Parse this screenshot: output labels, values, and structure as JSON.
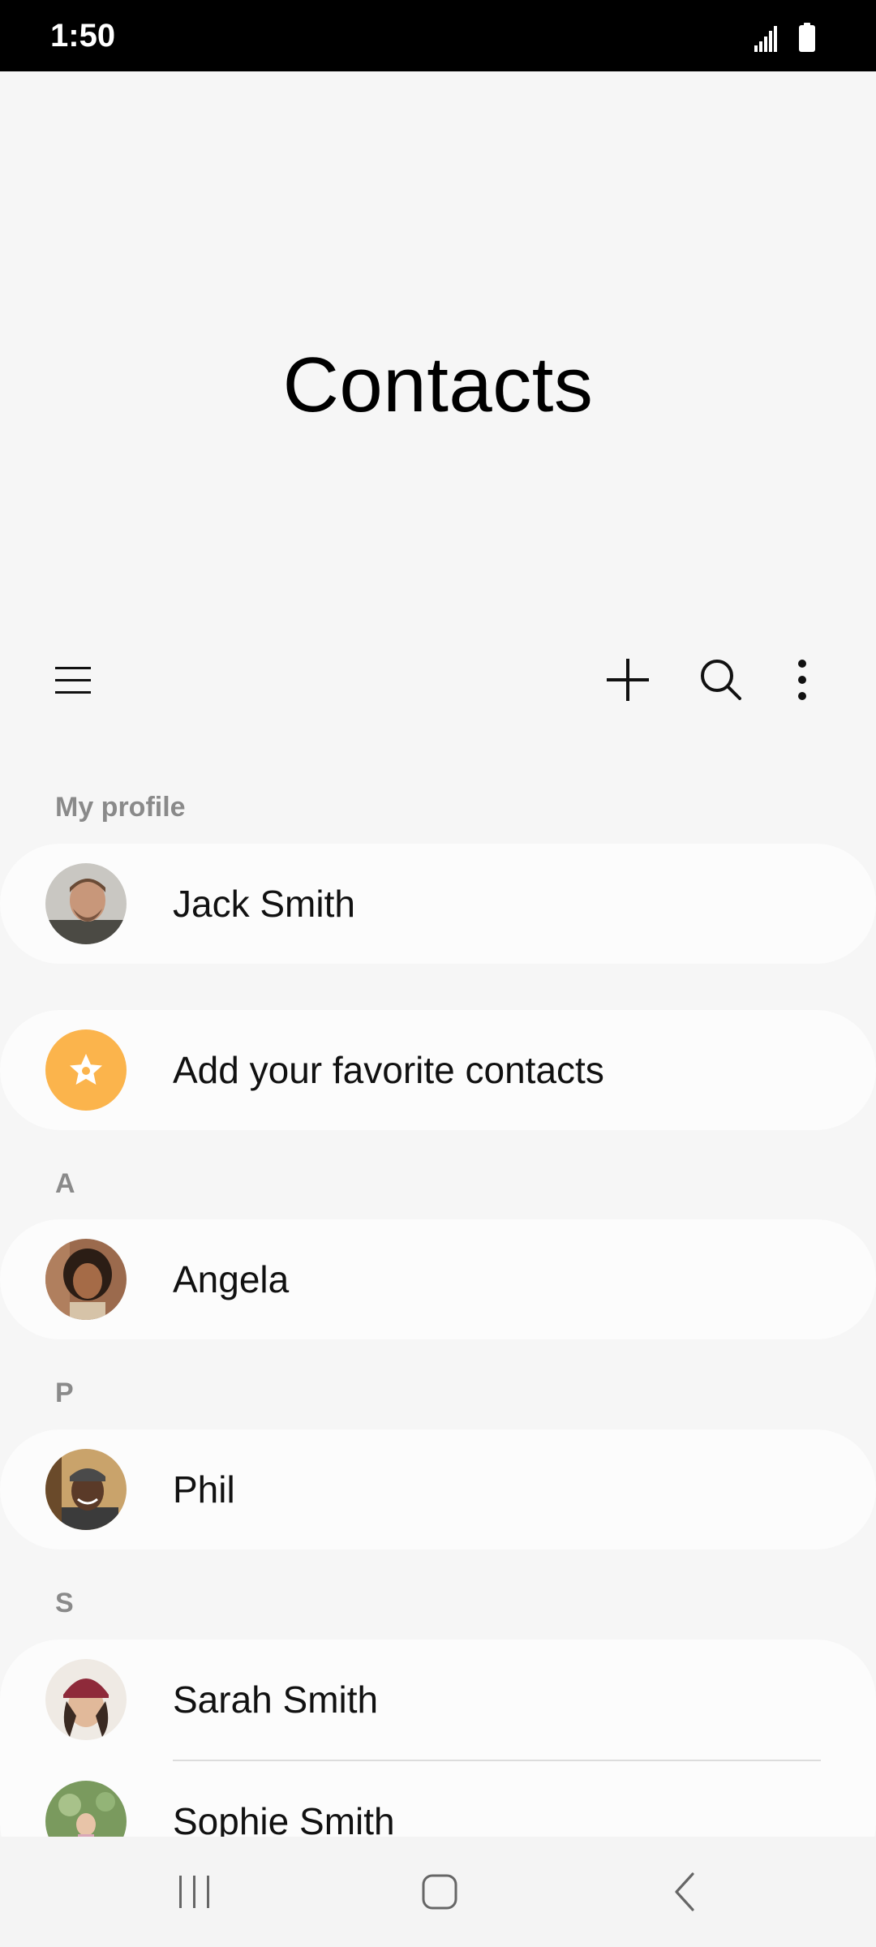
{
  "status_bar": {
    "time": "1:50",
    "icons": [
      "signal-icon",
      "battery-icon"
    ]
  },
  "app": {
    "title": "Contacts"
  },
  "toolbar": {
    "icons": [
      "menu-icon",
      "add-icon",
      "search-icon",
      "more-options-icon"
    ]
  },
  "profile": {
    "section_label": "My profile",
    "name": "Jack Smith"
  },
  "favorites": {
    "label": "Add your favorite contacts",
    "color": "#fbb44c"
  },
  "sections": [
    {
      "letter": "A",
      "contacts": [
        {
          "name": "Angela"
        }
      ]
    },
    {
      "letter": "P",
      "contacts": [
        {
          "name": "Phil"
        }
      ]
    },
    {
      "letter": "S",
      "contacts": [
        {
          "name": "Sarah Smith"
        },
        {
          "name": "Sophie Smith"
        }
      ]
    }
  ],
  "nav_bar": {
    "icons": [
      "recent-apps-icon",
      "home-icon",
      "back-icon"
    ]
  },
  "colors": {
    "background": "#f6f6f6",
    "card": "#fcfcfc",
    "section_text": "#8a8a8a",
    "accent_star": "#fbb44c"
  }
}
